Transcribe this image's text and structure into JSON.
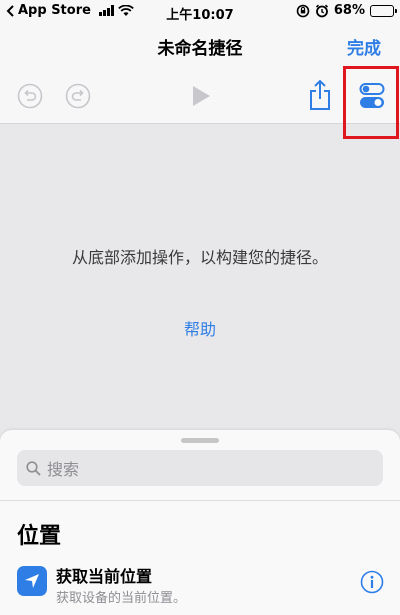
{
  "status_bar": {
    "carrier": "App Store",
    "time": "上午10:07",
    "battery_percent": "68%",
    "battery_level": 0.68
  },
  "nav": {
    "title": "未命名捷径",
    "done_label": "完成"
  },
  "toolbar": {
    "undo_icon": "undo-icon",
    "redo_icon": "redo-icon",
    "play_icon": "play-icon",
    "share_icon": "share-icon",
    "settings_icon": "toggle-settings-icon"
  },
  "empty_state": {
    "message": "从底部添加操作，以构建您的捷径。",
    "help_label": "帮助"
  },
  "sheet": {
    "search_placeholder": "搜索",
    "section_title": "位置",
    "actions": [
      {
        "title": "获取当前位置",
        "subtitle": "获取设备的当前位置。",
        "icon": "location-arrow-icon"
      }
    ]
  },
  "colors": {
    "accent": "#2f7ee6",
    "highlight": "#e0161e",
    "disabled": "#c7c7cc"
  }
}
